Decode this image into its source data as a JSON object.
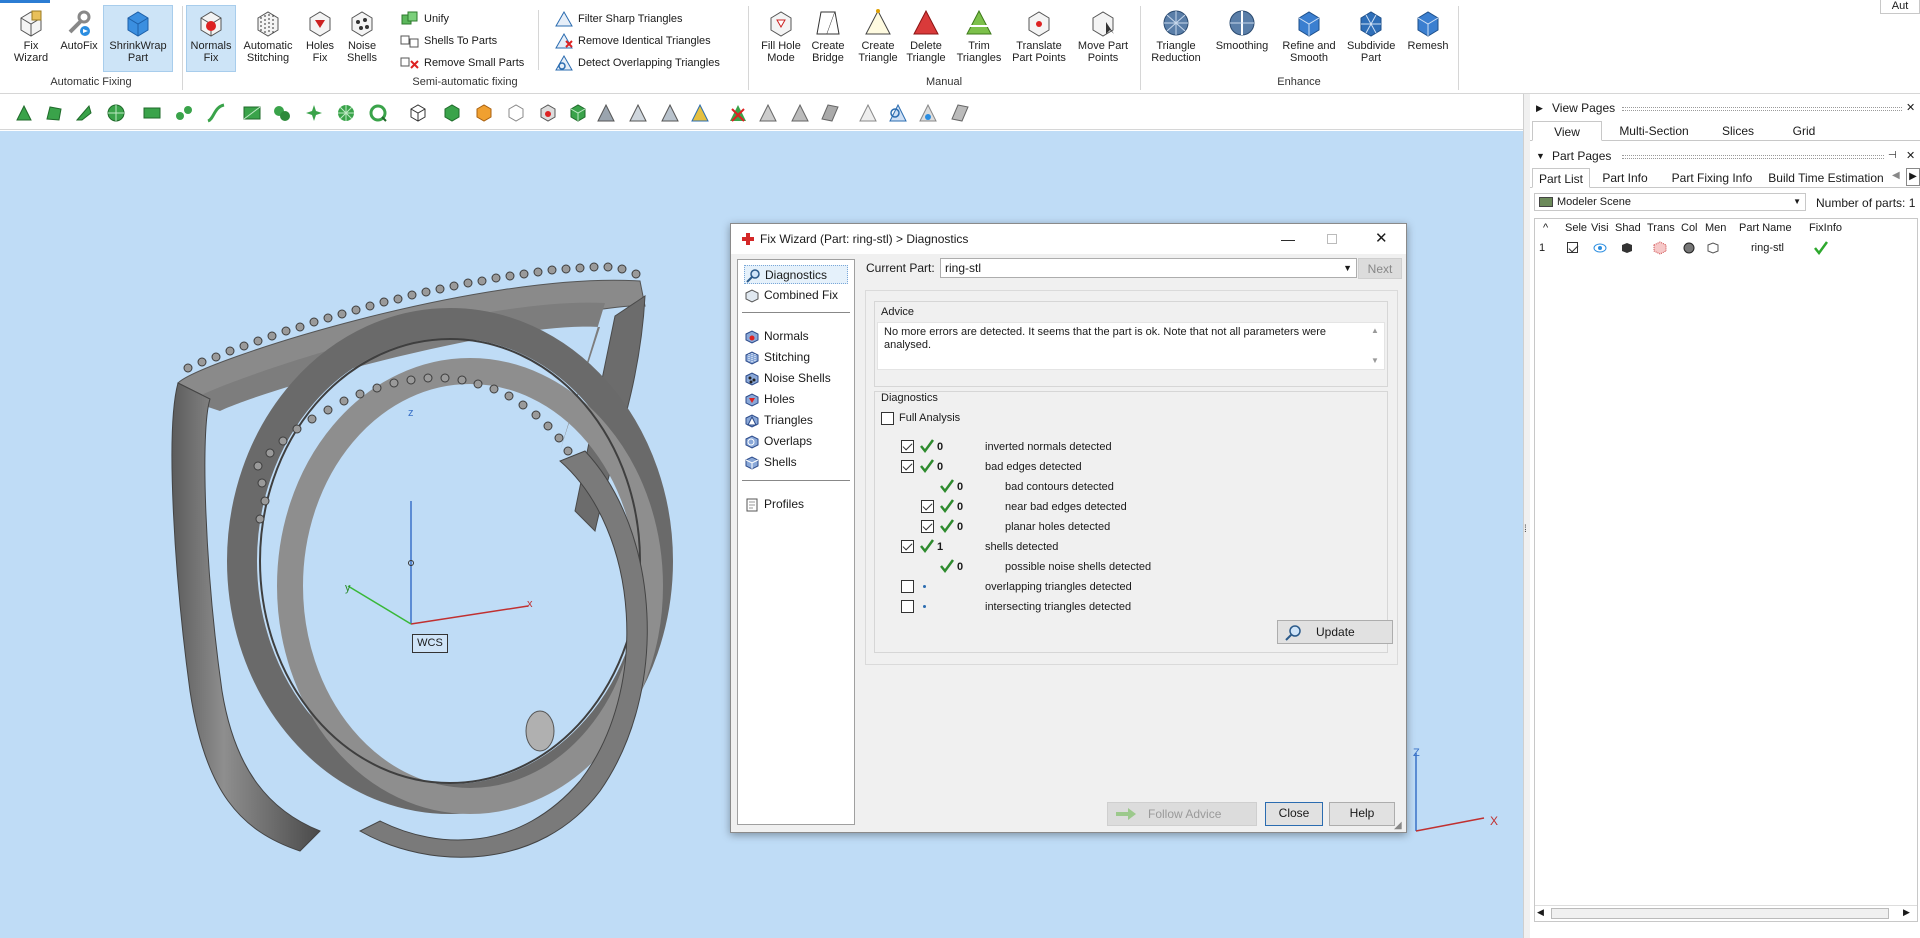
{
  "ribbon": {
    "top_right": "Aut",
    "auto_fixing": {
      "label": "Automatic Fixing",
      "fix_wizard": "Fix Wizard",
      "autofix": "AutoFix",
      "shrinkwrap": "ShrinkWrap Part"
    },
    "semi": {
      "label": "Semi-automatic fixing",
      "normals_fix": "Normals Fix",
      "auto_stitching": "Automatic Stitching",
      "holes_fix": "Holes Fix",
      "noise_shells": "Noise Shells",
      "unify": "Unify",
      "shells_to_parts": "Shells To Parts",
      "remove_small_parts": "Remove Small Parts",
      "filter_sharp": "Filter Sharp Triangles",
      "remove_identical": "Remove Identical Triangles",
      "detect_overlapping": "Detect Overlapping Triangles"
    },
    "manual": {
      "label": "Manual",
      "fill_hole_mode": "Fill Hole Mode",
      "create_bridge": "Create Bridge",
      "create_triangle": "Create Triangle",
      "delete_triangle": "Delete Triangle",
      "trim_triangles": "Trim Triangles",
      "translate_part_points": "Translate Part Points",
      "move_part_points": "Move Part Points"
    },
    "enhance": {
      "label": "Enhance",
      "triangle_reduction": "Triangle Reduction",
      "smoothing": "Smoothing",
      "refine_and_smooth": "Refine and Smooth",
      "subdivide_part": "Subdivide Part",
      "remesh": "Remesh"
    }
  },
  "viewport": {
    "wcs_label": "WCS",
    "axis_x": "x",
    "axis_y": "y",
    "axis_z": "z",
    "corner_axis_x": "X",
    "corner_axis_z": "Z"
  },
  "right_panel": {
    "view_pages": {
      "title": "View Pages",
      "tabs": [
        "View",
        "Multi-Section",
        "Slices",
        "Grid"
      ]
    },
    "part_pages": {
      "title": "Part Pages",
      "tabs": [
        "Part List",
        "Part Info",
        "Part Fixing Info",
        "Build Time Estimation"
      ],
      "scene_select": "Modeler Scene",
      "parts_count_label": "Number of parts:",
      "parts_count": "1",
      "columns": [
        "^",
        "Sele",
        "Visi",
        "Shad",
        "Trans",
        "Col",
        "Men",
        "Part Name",
        "FixInfo"
      ],
      "rows": [
        {
          "index": "1",
          "name": "ring-stl"
        }
      ]
    }
  },
  "dialog": {
    "title": "Fix Wizard (Part: ring-stl) > Diagnostics",
    "nav": {
      "diagnostics": "Diagnostics",
      "combined_fix": "Combined Fix",
      "normals": "Normals",
      "stitching": "Stitching",
      "noise_shells": "Noise Shells",
      "holes": "Holes",
      "triangles": "Triangles",
      "overlaps": "Overlaps",
      "shells": "Shells",
      "profiles": "Profiles"
    },
    "current_part_label": "Current Part:",
    "current_part_value": "ring-stl",
    "next_button": "Next",
    "advice_title": "Advice",
    "advice_text": "No more errors are detected. It seems that the part is ok. Note that not all parameters were analysed.",
    "diagnostics_title": "Diagnostics",
    "full_analysis": "Full Analysis",
    "checks": [
      {
        "count": "0",
        "label": "inverted normals detected"
      },
      {
        "count": "0",
        "label": "bad edges detected"
      },
      {
        "count": "0",
        "label": "bad contours detected"
      },
      {
        "count": "0",
        "label": "near bad edges detected"
      },
      {
        "count": "0",
        "label": "planar holes detected"
      },
      {
        "count": "1",
        "label": "shells detected"
      },
      {
        "count": "0",
        "label": "possible noise shells detected"
      },
      {
        "count": "",
        "label": "overlapping triangles detected"
      },
      {
        "count": "",
        "label": "intersecting triangles detected"
      }
    ],
    "update_button": "Update",
    "follow_advice_button": "Follow Advice",
    "close_button": "Close",
    "help_button": "Help"
  }
}
